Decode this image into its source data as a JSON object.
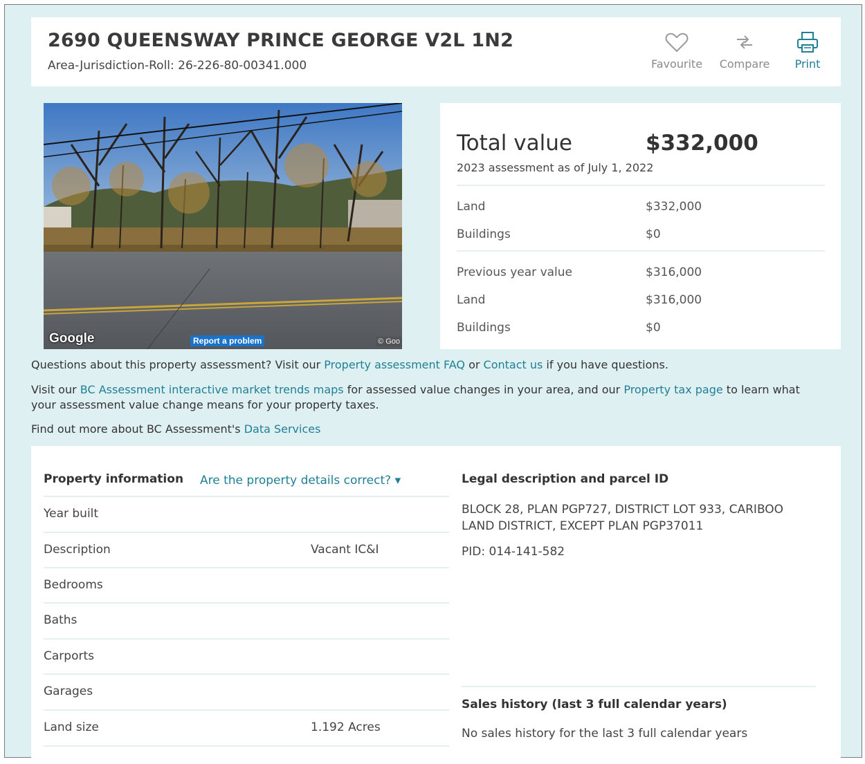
{
  "header": {
    "title": "2690 QUEENSWAY PRINCE GEORGE V2L 1N2",
    "roll": "Area-Jurisdiction-Roll: 26-226-80-00341.000",
    "actions": {
      "favourite": "Favourite",
      "compare": "Compare",
      "print": "Print"
    }
  },
  "photo": {
    "google": "Google",
    "report": "Report a problem",
    "copyright": "© Goo"
  },
  "valuation": {
    "total_label": "Total value",
    "total_amount": "$332,000",
    "assessment_date": "2023 assessment as of July 1, 2022",
    "current": [
      {
        "label": "Land",
        "value": "$332,000"
      },
      {
        "label": "Buildings",
        "value": "$0"
      }
    ],
    "previous": [
      {
        "label": "Previous year value",
        "value": "$316,000"
      },
      {
        "label": "Land",
        "value": "$316,000"
      },
      {
        "label": "Buildings",
        "value": "$0"
      }
    ]
  },
  "info_text": {
    "q1": "Questions about this property assessment? Visit our ",
    "q_link1": "Property assessment FAQ",
    "q2": " or ",
    "q_link2": "Contact us",
    "q3": " if you have questions.",
    "v1": "Visit our ",
    "v_link1": "BC Assessment interactive market trends maps",
    "v2": " for assessed value changes in your area, and our ",
    "v_link2": "Property tax page",
    "v3": " to learn what your assessment value change means for your property taxes.",
    "f1": "Find out more about BC Assessment's ",
    "f_link": "Data Services"
  },
  "property_info": {
    "heading": "Property information",
    "toggle": "Are the property details correct? ▾",
    "rows": [
      {
        "label": "Year built",
        "value": ""
      },
      {
        "label": "Description",
        "value": "Vacant IC&I"
      },
      {
        "label": "Bedrooms",
        "value": ""
      },
      {
        "label": "Baths",
        "value": ""
      },
      {
        "label": "Carports",
        "value": ""
      },
      {
        "label": "Garages",
        "value": ""
      },
      {
        "label": "Land size",
        "value": "1.192 Acres"
      }
    ]
  },
  "legal": {
    "heading": "Legal description and parcel ID",
    "text": "BLOCK 28, PLAN PGP727, DISTRICT LOT 933, CARIBOO LAND DISTRICT, EXCEPT PLAN PGP37011",
    "pid": "PID: 014-141-582"
  },
  "sales": {
    "heading": "Sales history (last 3 full calendar years)",
    "text": "No sales history for the last 3 full calendar years"
  },
  "colors": {
    "page_bg": "#dff0f2",
    "link": "#1f7f95",
    "divider": "#e4eff0"
  }
}
